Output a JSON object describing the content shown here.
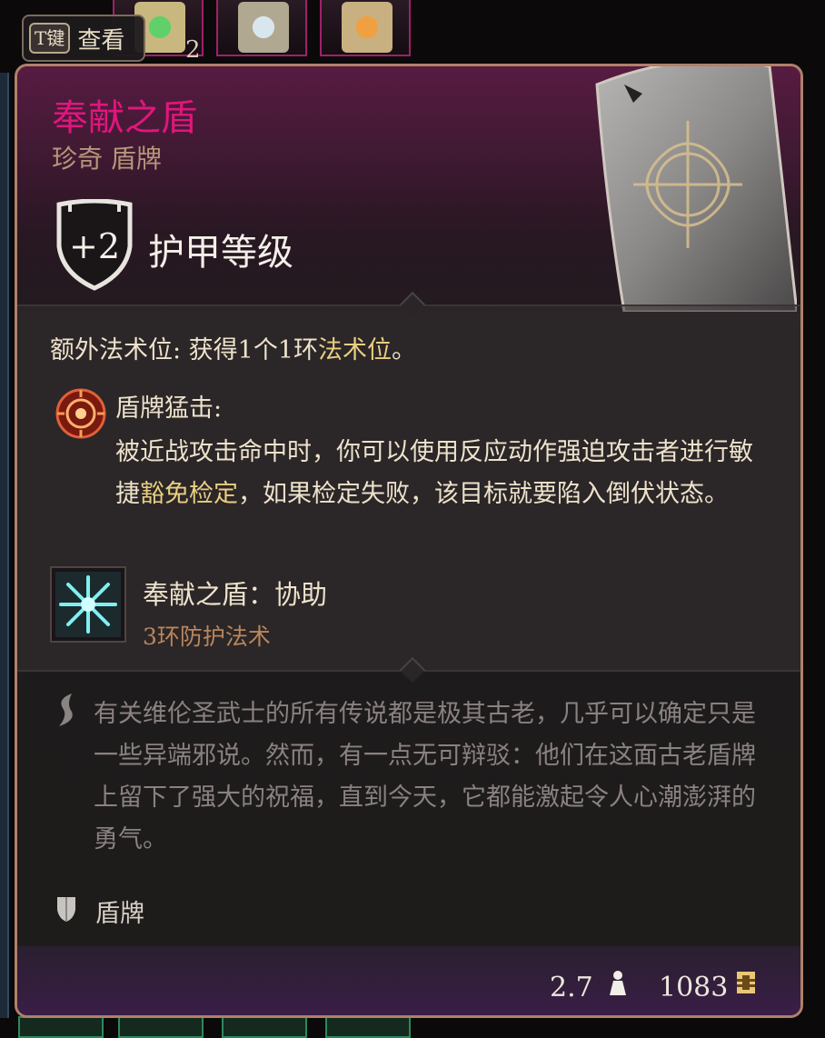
{
  "hint": {
    "key": "T键",
    "label": "查看"
  },
  "inventory": {
    "stack_count": "2"
  },
  "item": {
    "name": "奉献之盾",
    "rarity_type": "珍奇 盾牌",
    "armor_class_value": "+2",
    "armor_class_label": "护甲等级",
    "extra_spell_slot": {
      "label": "额外法术位: 获得1个1环",
      "highlight": "法术位",
      "suffix": "。"
    },
    "shield_bash": {
      "title": "盾牌猛击:",
      "desc_part1": "被近战攻击命中时，你可以使用反应动作强迫攻击者进行敏捷",
      "desc_highlight": "豁免检定",
      "desc_part2": "，如果检定失败，该目标就要陷入倒伏状态。"
    },
    "spell": {
      "name": "奉献之盾：协助",
      "level": "3环防护法术"
    },
    "lore": "有关维伦圣武士的所有传说都是极其古老，几乎可以确定只是一些异端邪说。然而，有一点无可辩驳：他们在这面古老盾牌上留下了强大的祝福，直到今天，它都能激起令人心潮澎湃的勇气。",
    "type_label": "盾牌",
    "weight": "2.7",
    "price": "1083"
  },
  "colors": {
    "title": "#e1157c",
    "highlight": "#e8cf82",
    "lore": "#8a8280",
    "panel_border": "#b0806a"
  },
  "icons": {
    "shield_badge": "shield-outline-icon",
    "bash": "shield-bash-icon",
    "spell": "snowflake-ward-icon",
    "lore": "scroll-quill-icon",
    "type": "shield-small-icon",
    "weight": "weight-icon",
    "price": "gold-coin-icon"
  }
}
